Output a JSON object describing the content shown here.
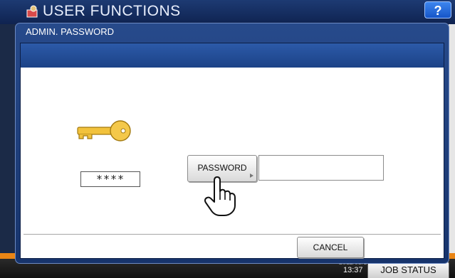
{
  "background": {
    "title": "USER FUNCTIONS",
    "help_label": "?",
    "clock_date": "2011/03/10",
    "clock_time": "13:37",
    "job_status_label": "JOB STATUS"
  },
  "dialog": {
    "title": "ADMIN. PASSWORD",
    "password_button_label": "PASSWORD",
    "password_value": "",
    "stars_text": "****",
    "cancel_label": "CANCEL"
  },
  "colors": {
    "accent_blue": "#1c4287",
    "orange_bar": "#e98515"
  },
  "icons": {
    "key": "key-icon",
    "hand": "pointing-hand-icon",
    "app": "user-functions-icon"
  }
}
